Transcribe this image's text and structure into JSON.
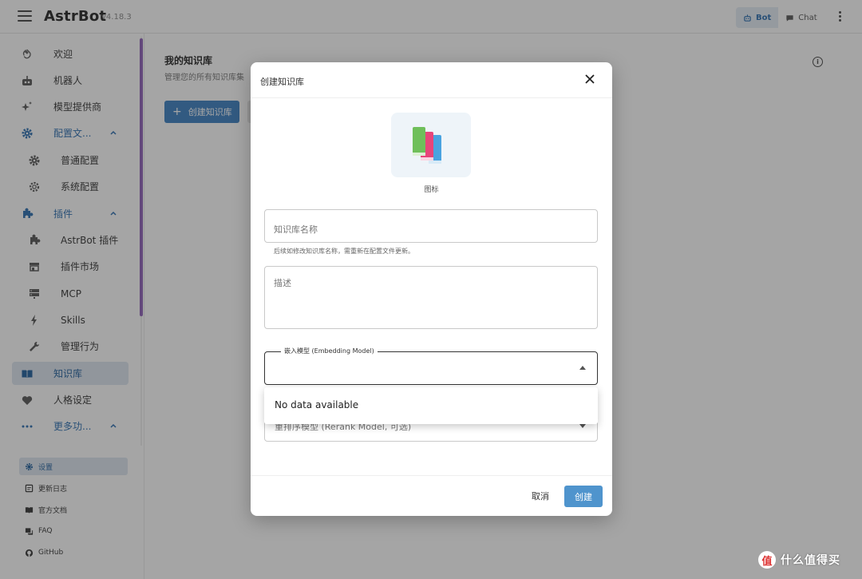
{
  "app": {
    "name": "AstrBot",
    "version": "v4.18.3"
  },
  "topbar": {
    "bot_label": "Bot",
    "chat_label": "Chat"
  },
  "sidebar": {
    "items": [
      {
        "label": "欢迎"
      },
      {
        "label": "机器人"
      },
      {
        "label": "模型提供商"
      },
      {
        "label": "配置文..."
      },
      {
        "label": "普通配置"
      },
      {
        "label": "系统配置"
      },
      {
        "label": "插件"
      },
      {
        "label": "AstrBot 插件"
      },
      {
        "label": "插件市场"
      },
      {
        "label": "MCP"
      },
      {
        "label": "Skills"
      },
      {
        "label": "管理行为"
      },
      {
        "label": "知识库"
      },
      {
        "label": "人格设定"
      },
      {
        "label": "更多功..."
      }
    ],
    "footer": [
      {
        "label": "设置"
      },
      {
        "label": "更新日志"
      },
      {
        "label": "官方文档"
      },
      {
        "label": "FAQ"
      },
      {
        "label": "GitHub"
      }
    ]
  },
  "main": {
    "title": "我的知识库",
    "subtitle": "管理您的所有知识库集",
    "create_button": "创建知识库"
  },
  "dialog": {
    "title": "创建知识库",
    "icon_caption": "图标",
    "name_placeholder": "知识库名称",
    "name_hint": "后续如修改知识库名称，需重新在配置文件更新。",
    "desc_placeholder": "描述",
    "embedding_label": "嵌入模型 (Embedding Model)",
    "dropdown_empty": "No data available",
    "rerank_label": "重排序模型 (Rerank Model, 可选)",
    "cancel": "取消",
    "create": "创建"
  },
  "watermark": {
    "text": "什么值得买",
    "logo": "值"
  },
  "colors": {
    "primary": "#3a7fc1",
    "active_bg": "#dde6ef",
    "scroll_accent": "#8e5fb8"
  }
}
